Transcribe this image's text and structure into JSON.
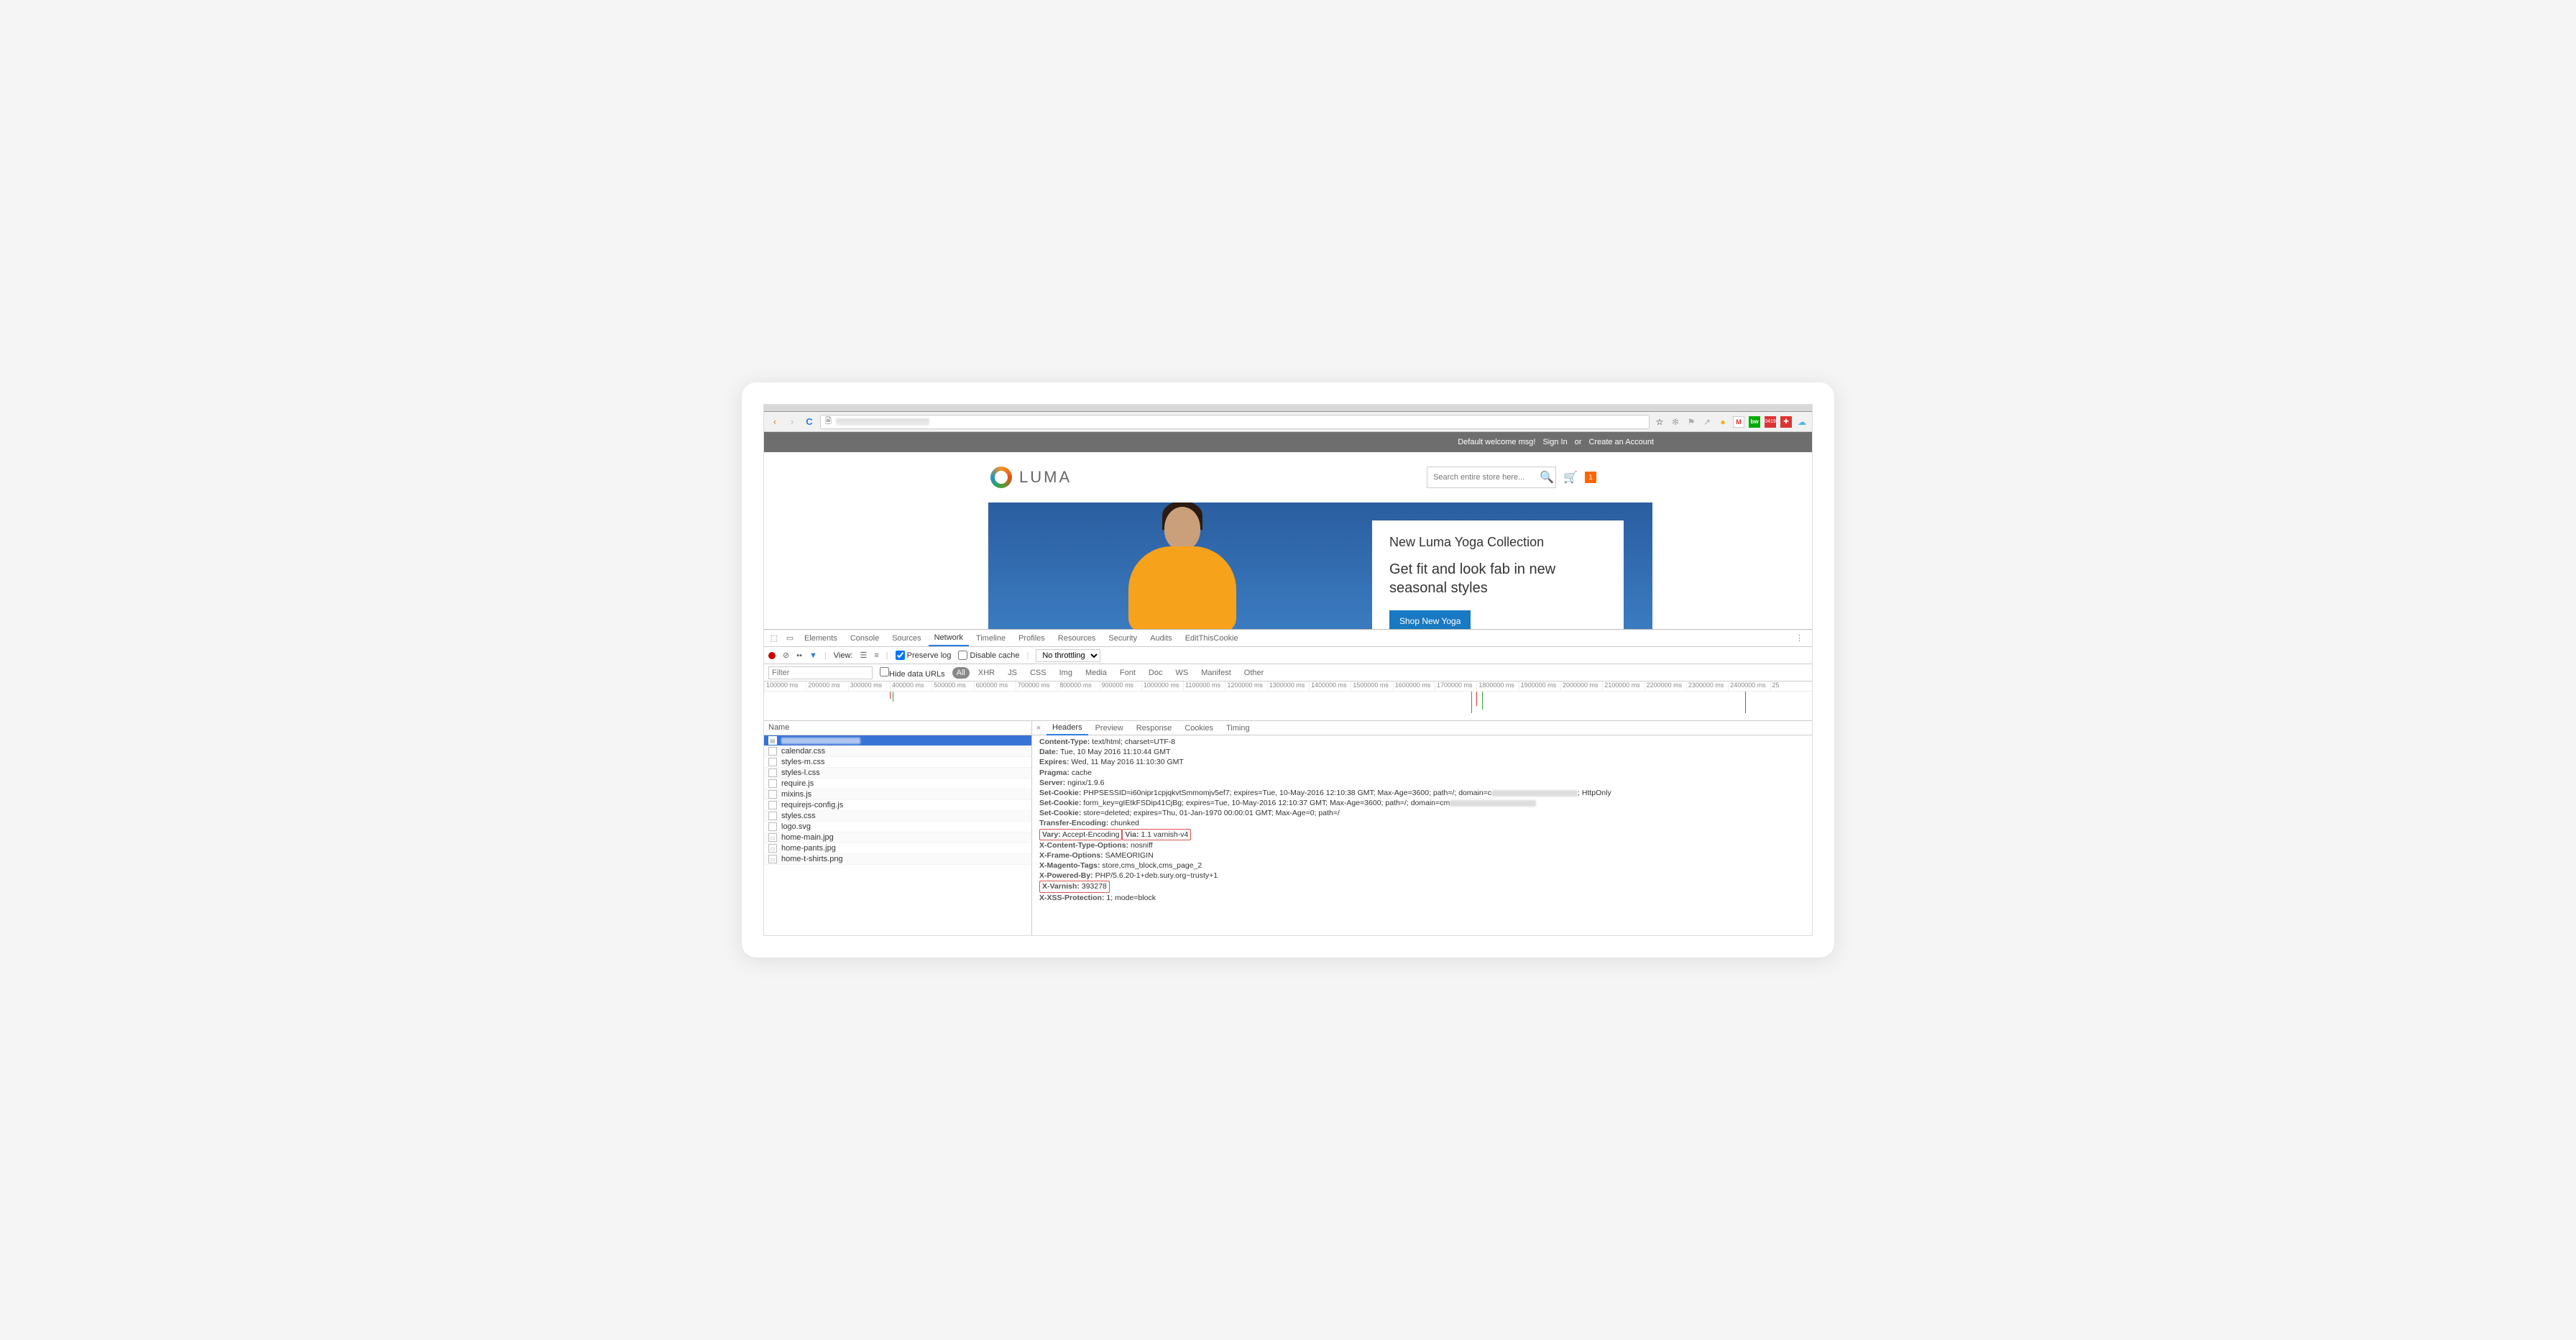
{
  "browser": {
    "back_icon": "‹",
    "fwd_icon": "›",
    "reload_icon": "C",
    "page_icon": "🗎",
    "star_icon": "☆"
  },
  "page": {
    "welcome": "Default welcome msg!",
    "signin": "Sign In",
    "or": "or",
    "create": "Create an Account",
    "brand": "LUMA",
    "search_ph": "Search entire store here...",
    "cart_count": "1",
    "hero_title": "New Luma Yoga Collection",
    "hero_sub": "Get fit and look fab in new seasonal styles",
    "hero_cta": "Shop New Yoga"
  },
  "devtools": {
    "tabs": [
      "Elements",
      "Console",
      "Sources",
      "Network",
      "Timeline",
      "Profiles",
      "Resources",
      "Security",
      "Audits",
      "EditThisCookie"
    ],
    "active_tab": "Network",
    "view_label": "View:",
    "preserve": "Preserve log",
    "disable_cache": "Disable cache",
    "throttle": "No throttling",
    "filter_ph": "Filter",
    "hide_urls": "Hide data URLs",
    "ftabs": [
      "All",
      "XHR",
      "JS",
      "CSS",
      "Img",
      "Media",
      "Font",
      "Doc",
      "WS",
      "Manifest",
      "Other"
    ],
    "active_ftab": "All",
    "ticks": [
      "100000 ms",
      "200000 ms",
      "300000 ms",
      "400000 ms",
      "500000 ms",
      "600000 ms",
      "700000 ms",
      "800000 ms",
      "900000 ms",
      "1000000 ms",
      "1100000 ms",
      "1200000 ms",
      "1300000 ms",
      "1400000 ms",
      "1500000 ms",
      "1600000 ms",
      "1700000 ms",
      "1800000 ms",
      "1900000 ms",
      "2000000 ms",
      "2100000 ms",
      "2200000 ms",
      "2300000 ms",
      "2400000 ms",
      "25"
    ],
    "name_hdr": "Name",
    "requests": [
      {
        "name": "",
        "sel": true,
        "blur": true,
        "icon": "▤"
      },
      {
        "name": "calendar.css",
        "icon": ""
      },
      {
        "name": "styles-m.css",
        "icon": ""
      },
      {
        "name": "styles-l.css",
        "icon": ""
      },
      {
        "name": "require.js",
        "icon": ""
      },
      {
        "name": "mixins.js",
        "icon": ""
      },
      {
        "name": "requirejs-config.js",
        "icon": ""
      },
      {
        "name": "styles.css",
        "icon": ""
      },
      {
        "name": "logo.svg",
        "icon": ""
      },
      {
        "name": "home-main.jpg",
        "icon": "▭"
      },
      {
        "name": "home-pants.jpg",
        "icon": "▭"
      },
      {
        "name": "home-t-shirts.png",
        "icon": "▭"
      }
    ],
    "detail_tabs": [
      "Headers",
      "Preview",
      "Response",
      "Cookies",
      "Timing"
    ],
    "active_detail": "Headers",
    "headers": [
      {
        "k": "Content-Type:",
        "v": " text/html; charset=UTF-8"
      },
      {
        "k": "Date:",
        "v": " Tue, 10 May 2016 11:10:44 GMT"
      },
      {
        "k": "Expires:",
        "v": " Wed, 11 May 2016 11:10:30 GMT"
      },
      {
        "k": "Pragma:",
        "v": " cache"
      },
      {
        "k": "Server:",
        "v": " nginx/1.9.6"
      },
      {
        "k": "Set-Cookie:",
        "v": " PHPSESSID=i60nipr1cpjqkvtSmmomjv5ef7; expires=Tue, 10-May-2016 12:10:38 GMT; Max-Age=3600; path=/; domain=c",
        "blur": true,
        "tail": "; HttpOnly"
      },
      {
        "k": "Set-Cookie:",
        "v": " form_key=gIEtkFSDip41CjBg; expires=Tue, 10-May-2016 12:10:37 GMT; Max-Age=3600; path=/; domain=cm",
        "blur": true
      },
      {
        "k": "Set-Cookie:",
        "v": " store=deleted; expires=Thu, 01-Jan-1970 00:00:01 GMT; Max-Age=0; path=/"
      },
      {
        "k": "Transfer-Encoding:",
        "v": " chunked"
      },
      {
        "k": "Vary:",
        "v": " Accept-Encoding",
        "box": true
      },
      {
        "k": "Via:",
        "v": " 1.1 varnish-v4",
        "box": true
      },
      {
        "k": "X-Content-Type-Options:",
        "v": " nosniff"
      },
      {
        "k": "X-Frame-Options:",
        "v": " SAMEORIGIN"
      },
      {
        "k": "X-Magento-Tags:",
        "v": " store,cms_block,cms_page_2"
      },
      {
        "k": "X-Powered-By:",
        "v": " PHP/5.6.20-1+deb.sury.org~trusty+1"
      },
      {
        "k": "X-Varnish:",
        "v": " 393278",
        "box": true
      },
      {
        "k": "X-XSS-Protection:",
        "v": " 1; mode=block"
      }
    ]
  }
}
